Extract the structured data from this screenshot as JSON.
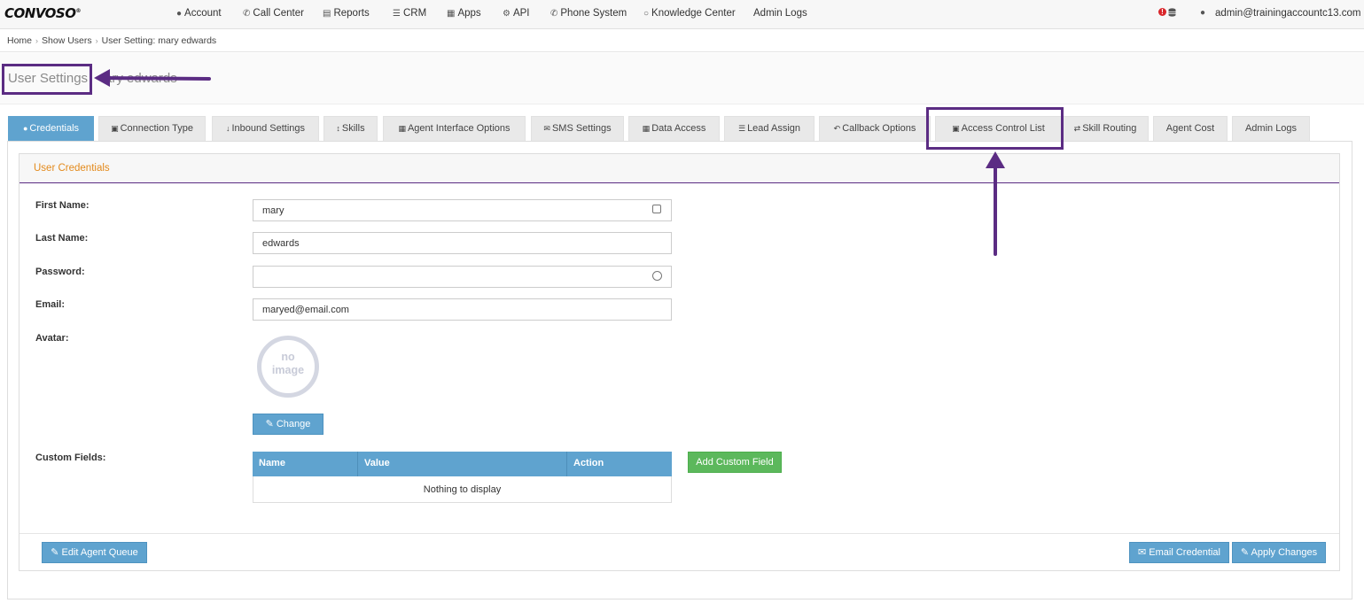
{
  "brand": {
    "logo": "CONVOSO",
    "trademark": "®"
  },
  "nav": {
    "items": [
      {
        "label": "Account",
        "icon": "user-icon"
      },
      {
        "label": "Call Center",
        "icon": "phone-icon"
      },
      {
        "label": "Reports",
        "icon": "bar-chart-icon"
      },
      {
        "label": "CRM",
        "icon": "list-icon"
      },
      {
        "label": "Apps",
        "icon": "grid-icon"
      },
      {
        "label": "API",
        "icon": "gear-icon"
      },
      {
        "label": "Phone System",
        "icon": "phone-icon"
      },
      {
        "label": "Knowledge Center",
        "icon": "lightbulb-icon"
      },
      {
        "label": "Admin Logs",
        "icon": ""
      }
    ],
    "alert_badge": "!",
    "user_email": "admin@trainingaccountc13.com"
  },
  "breadcrumb": [
    "Home",
    "Show Users",
    "User Setting: mary edwards"
  ],
  "page": {
    "title": "User Settings",
    "title_suffix": "ary edwards"
  },
  "tabs": [
    {
      "label": "Credentials",
      "icon": "user-icon",
      "active": true
    },
    {
      "label": "Connection Type",
      "icon": "lock-icon"
    },
    {
      "label": "Inbound Settings",
      "icon": "arrow-down-icon"
    },
    {
      "label": "Skills",
      "icon": "arrows-vertical-icon"
    },
    {
      "label": "Agent Interface Options",
      "icon": "grid-icon"
    },
    {
      "label": "SMS Settings",
      "icon": "envelope-icon"
    },
    {
      "label": "Data Access",
      "icon": "grid-icon"
    },
    {
      "label": "Lead Assign",
      "icon": "list-ordered-icon"
    },
    {
      "label": "Callback Options",
      "icon": "reply-icon"
    },
    {
      "label": "Access Control List",
      "icon": "lock-icon"
    },
    {
      "label": "Skill Routing",
      "icon": "shuffle-icon"
    },
    {
      "label": "Agent Cost",
      "icon": ""
    },
    {
      "label": "Admin Logs",
      "icon": ""
    }
  ],
  "panel": {
    "title": "User Credentials"
  },
  "form": {
    "first_name_label": "First Name:",
    "first_name_value": "mary",
    "last_name_label": "Last Name:",
    "last_name_value": "edwards",
    "password_label": "Password:",
    "password_value": "",
    "email_label": "Email:",
    "email_value": "maryed@email.com",
    "avatar_label": "Avatar:",
    "avatar_placeholder_line1": "no",
    "avatar_placeholder_line2": "image",
    "change_button": "Change",
    "custom_fields_label": "Custom Fields:"
  },
  "custom_fields_table": {
    "columns": [
      "Name",
      "Value",
      "Action"
    ],
    "empty_text": "Nothing to display"
  },
  "buttons": {
    "add_custom_field": "Add Custom Field",
    "edit_agent_queue": "Edit Agent Queue",
    "email_credential": "Email Credential",
    "apply_changes": "Apply Changes"
  },
  "annotation_color": "#5b2c83",
  "accent_blue": "#5fa3cf",
  "accent_orange": "#e38a1c",
  "accent_green": "#5cb85c"
}
